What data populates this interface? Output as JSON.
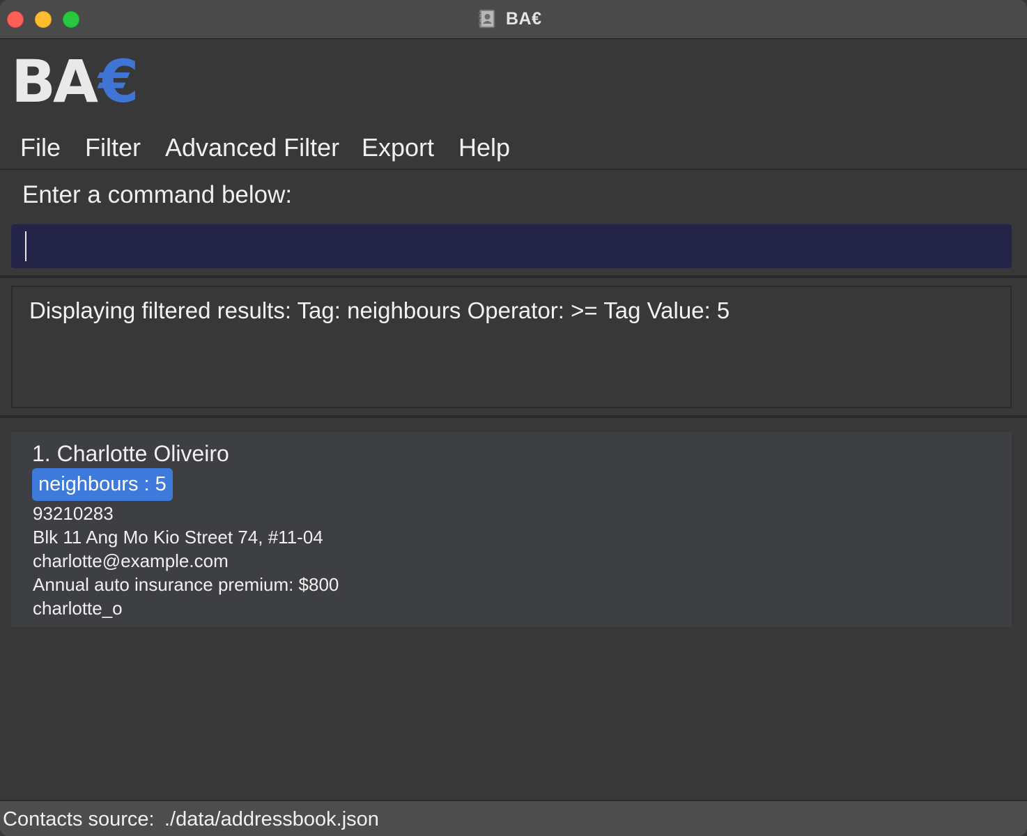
{
  "window": {
    "title": "BA€"
  },
  "logo": {
    "main": "BA",
    "accent": "€"
  },
  "menu": {
    "items": [
      "File",
      "Filter",
      "Advanced Filter",
      "Export",
      "Help"
    ]
  },
  "command": {
    "label": "Enter a command below:",
    "value": ""
  },
  "result": {
    "text": "Displaying filtered results: Tag: neighbours Operator: >= Tag Value: 5"
  },
  "persons": [
    {
      "name": "1. Charlotte Oliveiro",
      "tag": "neighbours : 5",
      "phone": "93210283",
      "address": "Blk 11 Ang Mo Kio Street 74, #11-04",
      "email": "charlotte@example.com",
      "note": "Annual auto insurance premium: $800",
      "username": "charlotte_o"
    }
  ],
  "status": {
    "label": "Contacts source:",
    "path": "./data/addressbook.json"
  },
  "colors": {
    "background": "#383838",
    "accent": "#3f76d6",
    "command_box": "#242448",
    "tag": "#3e7adb"
  },
  "icons": {
    "app": "address-book-icon"
  }
}
